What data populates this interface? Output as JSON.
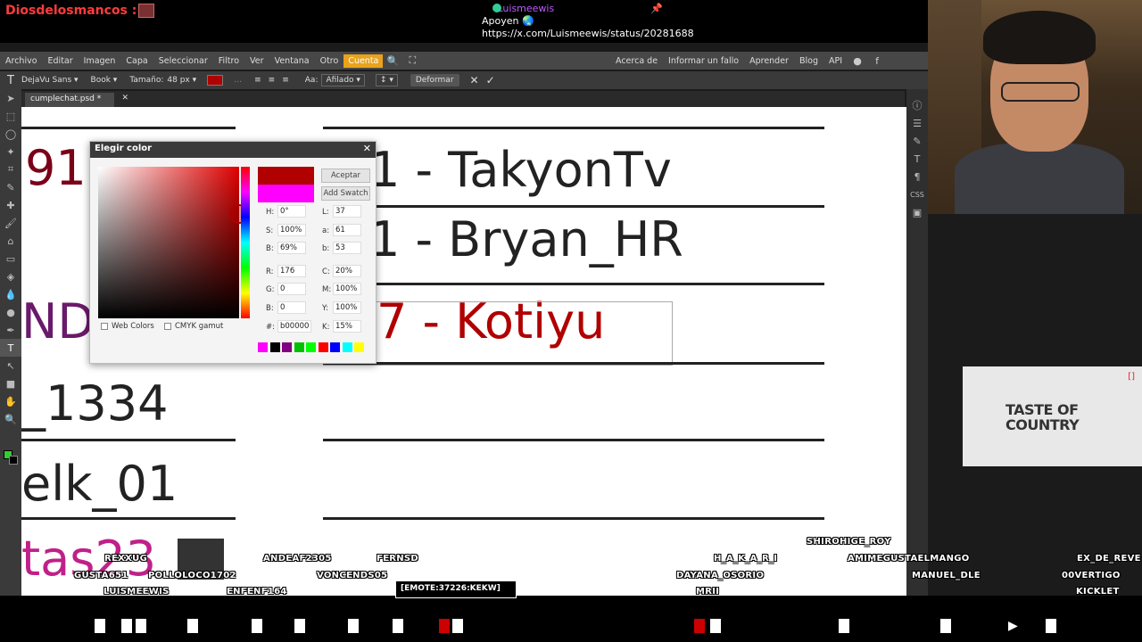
{
  "stream": {
    "channel_name": "Diosdelosmancos :",
    "chat_user": "Luismeewis",
    "chat_lines": [
      "Apoyen 🌏",
      "https://x.com/Luismeewis/status/20281688"
    ]
  },
  "menubar": {
    "items": [
      "Archivo",
      "Editar",
      "Imagen",
      "Capa",
      "Seleccionar",
      "Filtro",
      "Ver",
      "Ventana",
      "Otro",
      "Cuenta"
    ],
    "right_items": [
      "Acerca de",
      "Informar un fallo",
      "Aprender",
      "Blog",
      "API"
    ]
  },
  "options": {
    "font": "DejaVu Sans ▾",
    "style": "Book ▾",
    "size_label": "Tamaño:",
    "size_value": "48 px ▾",
    "aa_label": "Aa:",
    "aa_value": "Afilado",
    "deform": "Deformar",
    "text_color": "#b00000"
  },
  "tab": {
    "label": "cumplechat.psd *"
  },
  "canvas": {
    "lines": [
      "91",
      "- TakyonTv",
      "- Bryan_HR",
      "ND",
      "- Kotiyu",
      "_1334",
      "elk_01",
      "tas23"
    ],
    "line_digits": {
      "takyon": "1",
      "bryan": "1",
      "kotiyu": "7"
    }
  },
  "picker": {
    "title": "Elegir color",
    "accept": "Aceptar",
    "add_swatch": "Add Swatch",
    "fields": {
      "H": "0°",
      "S": "100%",
      "B": "69%",
      "L": "37",
      "a": "61",
      "b": "53",
      "R": "176",
      "G": "0",
      "Bl": "0",
      "C": "20%",
      "M": "100%",
      "Y": "100%",
      "K": "15%",
      "hex": "b00000"
    },
    "web_colors": "Web Colors",
    "cmyk_gamut": "CMYK gamut",
    "swatches": [
      "#ff00ff",
      "#000000",
      "#800080",
      "#00c000",
      "#00ff00",
      "#ff0000",
      "#0000ff",
      "#00ffff",
      "#ffff00"
    ]
  },
  "ad": {
    "line1": "TASTE OF",
    "line2": "COUNTRY"
  },
  "overlay_names": [
    "REXXUG",
    "GUSTA651",
    "POLLOLOCO1702",
    "LUISMEEWIS",
    "ANDEAF2305",
    "FERNSD",
    "VONCENDS05",
    "ENFENF164",
    "H_A_K_A_R_I",
    "DAYANA_OSORIO",
    "MRII",
    "SHIROHIGE_ROY",
    "AMIMEGUSTAELMANGO",
    "MANUEL_DLE",
    "EX_DE_REVE",
    "00VERTIGO",
    "KICKLET"
  ],
  "emote_label": "[EMOTE:37226:KEKW]"
}
